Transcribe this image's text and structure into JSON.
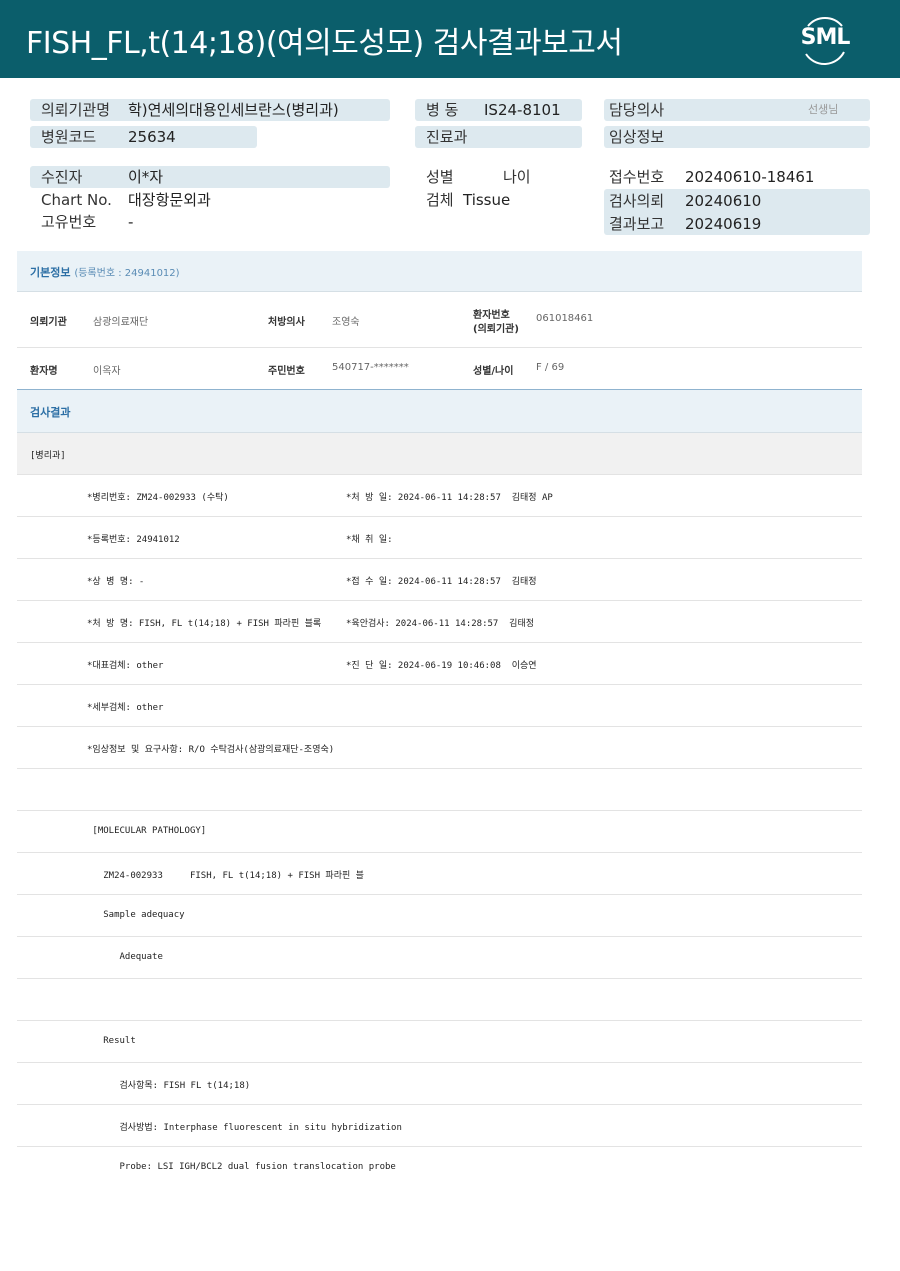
{
  "header": {
    "title": "FISH_FL,t(14;18)(여의도성모) 검사결과보고서",
    "logo": "SML"
  },
  "summary": {
    "institution_label": "의뢰기관명",
    "institution_value": "학)연세의대용인세브란스(병리과)",
    "hospital_code_label": "병원코드",
    "hospital_code_value": "25634",
    "ward_label": "병  동",
    "ward_value": "IS24-8101",
    "dept_label": "진료과",
    "doctor_label": "담당의사",
    "doctor_suffix": "선생님",
    "clinical_label": "임상정보",
    "patient_label": "수진자",
    "patient_value": "이*자",
    "chart_label": "Chart No.",
    "chart_value": "대장항문외과",
    "unique_label": "고유번호",
    "unique_value": "-",
    "sex_label": "성별",
    "age_label": "나이",
    "specimen_label": "검체",
    "specimen_value": "Tissue",
    "receipt_label": "접수번호",
    "receipt_value": "20240610-18461",
    "request_label": "검사의뢰",
    "request_value": "20240610",
    "report_label": "결과보고",
    "report_value": "20240619"
  },
  "basic_info": {
    "title": "기본정보",
    "reg_note": "(등록번호 : 24941012)",
    "row1": {
      "k1": "의뢰기관",
      "v1": "삼광의료재단",
      "k2": "처방의사",
      "v2": "조영숙",
      "k3a": "환자번호",
      "k3b": "(의뢰기관)",
      "v3": "061018461"
    },
    "row2": {
      "k1": "환자명",
      "v1": "이옥자",
      "k2": "주민번호",
      "v2": "540717-*******",
      "k3": "성별/나이",
      "v3": "F / 69"
    }
  },
  "results": {
    "title": "검사결과",
    "dept_header": "[병리과]",
    "lines": [
      {
        "left": "*병리번호: ZM24-002933 (수탁)",
        "right": "*처 방 일: 2024-06-11 14:28:57  김태정 AP"
      },
      {
        "left": "*등록번호: 24941012",
        "right": "*채 취 일:"
      },
      {
        "left": "*상 병 명: -",
        "right": "*접 수 일: 2024-06-11 14:28:57  김태정"
      },
      {
        "left": "*처 방 명: FISH, FL t(14;18) + FISH 파라핀 블록",
        "right": "*육안검사: 2024-06-11 14:28:57  김태정"
      },
      {
        "left": "*대표검체: other",
        "right": "*진 단 일: 2024-06-19 10:46:08  이승연"
      },
      {
        "left": "*세부검체: other",
        "right": ""
      },
      {
        "left": "*임상정보 및 요구사항: R/O 수탁검사(삼광의료재단-조영숙)",
        "right": ""
      },
      {
        "left": "",
        "right": ""
      },
      {
        "left": " [MOLECULAR PATHOLOGY]",
        "right": ""
      },
      {
        "left": "   ZM24-002933     FISH, FL t(14;18) + FISH 파라핀 블",
        "right": ""
      },
      {
        "left": "   Sample adequacy",
        "right": ""
      },
      {
        "left": "      Adequate",
        "right": ""
      },
      {
        "left": "",
        "right": ""
      },
      {
        "left": "   Result",
        "right": ""
      },
      {
        "left": "      검사항목: FISH FL t(14;18)",
        "right": ""
      },
      {
        "left": "      검사방법: Interphase fluorescent in situ hybridization",
        "right": ""
      },
      {
        "left": "      Probe: LSI IGH/BCL2 dual fusion translocation probe",
        "right": ""
      }
    ]
  }
}
